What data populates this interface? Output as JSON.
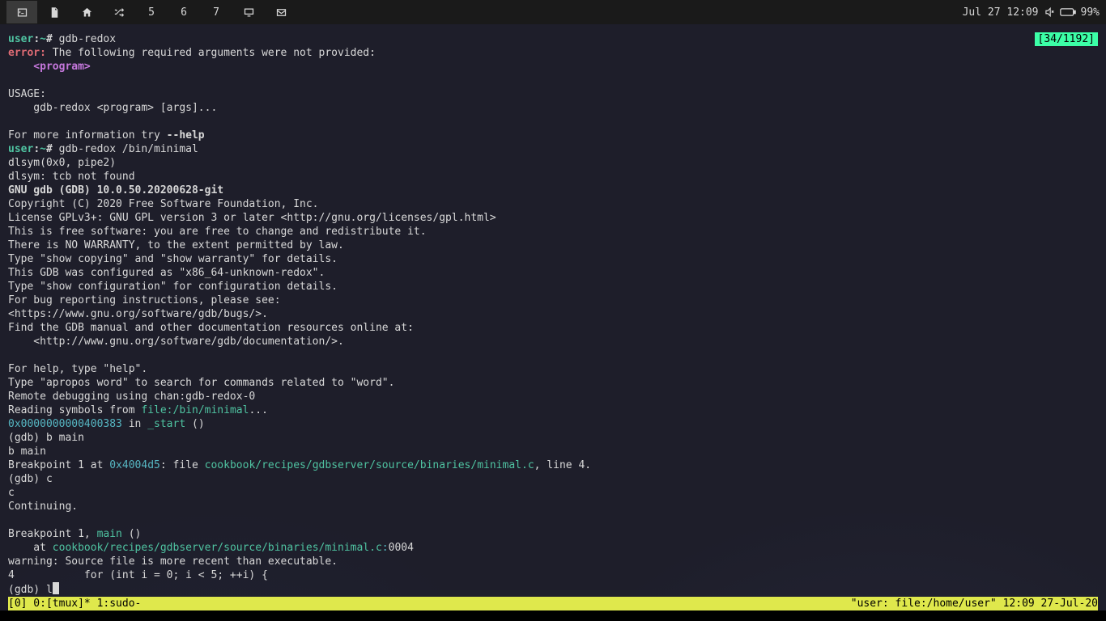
{
  "taskbar": {
    "items": [
      "terminal",
      "file",
      "home",
      "shuffle",
      "5",
      "6",
      "7",
      "monitor",
      "mail"
    ],
    "active_index": 0,
    "labels": {
      "ws5": "5",
      "ws6": "6",
      "ws7": "7"
    },
    "clock": "Jul 27 12:09",
    "battery": "99%"
  },
  "pos_badge": "[34/1192]",
  "prompt": {
    "user": "user",
    "host": "~",
    "sep": ":",
    "hash": "# "
  },
  "lines": {
    "cmd1": "gdb-redox",
    "error_lbl": "error:",
    "error_txt": " The following required arguments were not provided:",
    "missing_arg": "    <program>",
    "usage_hdr": "USAGE:",
    "usage_line": "    gdb-redox <program> [args]...",
    "moreinfo_pre": "For more information try ",
    "moreinfo_flag": "--help",
    "cmd2": "gdb-redox /bin/minimal",
    "dlsym1": "dlsym(0x0, pipe2)",
    "dlsym2": "dlsym: tcb not found",
    "gdb_banner": "GNU gdb (GDB) 10.0.50.20200628-git",
    "copyright": "Copyright (C) 2020 Free Software Foundation, Inc.",
    "license": "License GPLv3+: GNU GPL version 3 or later <http://gnu.org/licenses/gpl.html>",
    "free": "This is free software: you are free to change and redistribute it.",
    "warranty": "There is NO WARRANTY, to the extent permitted by law.",
    "show_copy": "Type \"show copying\" and \"show warranty\" for details.",
    "configured": "This GDB was configured as \"x86_64-unknown-redox\".",
    "show_conf": "Type \"show configuration\" for configuration details.",
    "bugrep": "For bug reporting instructions, please see:",
    "bugurl": "<https://www.gnu.org/software/gdb/bugs/>.",
    "manual": "Find the GDB manual and other documentation resources online at:",
    "manurl": "    <http://www.gnu.org/software/gdb/documentation/>.",
    "help1": "For help, type \"help\".",
    "help2": "Type \"apropos word\" to search for commands related to \"word\".",
    "remote": "Remote debugging using chan:gdb-redox-0",
    "reading_pre": "Reading symbols from ",
    "reading_file": "file:/bin/minimal",
    "reading_post": "...",
    "addr0": "0x0000000000400383",
    "in_txt": " in ",
    "start_sym": "_start",
    "parens": " ()",
    "gdb_prompt": "(gdb) ",
    "bmain1": "b main",
    "bmain2": "b main",
    "bp_pre": "Breakpoint 1 at ",
    "bp_addr": "0x4004d5",
    "bp_mid": ": file ",
    "bp_file": "cookbook/recipes/gdbserver/source/binaries/minimal.c",
    "bp_post": ", line 4.",
    "c_cmd": "c",
    "c_echo": "c",
    "continuing": "Continuing.",
    "bp_hit_pre": "Breakpoint 1, ",
    "bp_hit_sym": "main",
    "bp_hit_post": " ()",
    "at_pre": "    at ",
    "at_file": "cookbook/recipes/gdbserver/source/binaries/minimal.c",
    "at_colon": ":",
    "at_line": "0004",
    "warning": "warning: Source file is more recent than executable.",
    "src4": "4           for (int i = 0; i < 5; ++i) {",
    "last_gdb": "l"
  },
  "tmux": {
    "left": "[0] 0:[tmux]* 1:sudo-",
    "right": "\"user: file:/home/user\" 12:09 27-Jul-20"
  }
}
